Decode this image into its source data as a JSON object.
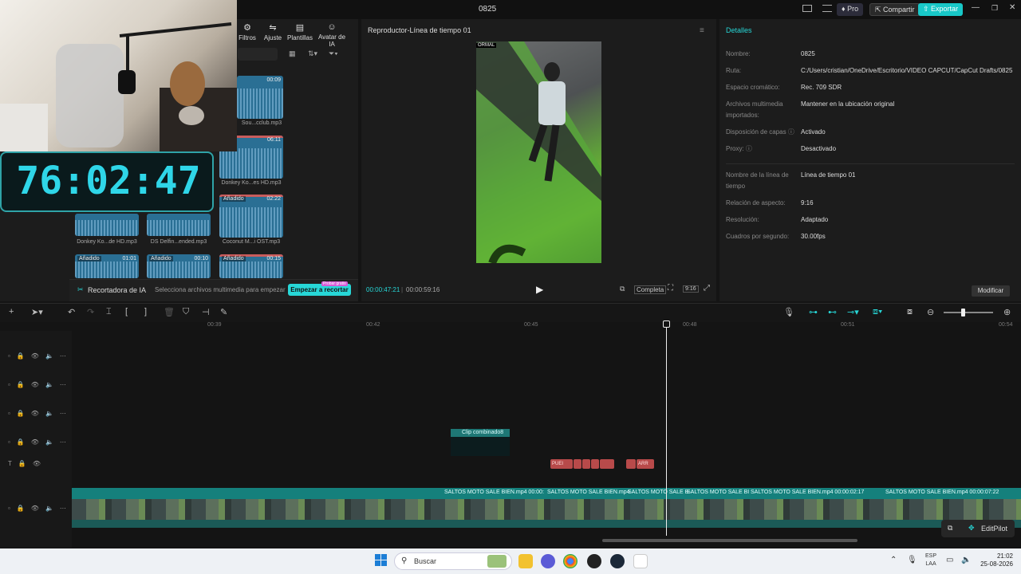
{
  "window": {
    "project_name": "0825",
    "pro_label": "Pro",
    "share_label": "Compartir",
    "export_label": "Exportar"
  },
  "media_panel": {
    "tabs": [
      {
        "label": "Filtros",
        "icon": "filter-icon"
      },
      {
        "label": "Ajuste",
        "icon": "adjust-icon"
      },
      {
        "label": "Plantillas",
        "icon": "template-icon"
      },
      {
        "label": "Avatar de IA",
        "icon": "avatar-icon"
      }
    ],
    "items": [
      {
        "name": "Sou...cclub.mp3",
        "duration": "00:09",
        "added": ""
      },
      {
        "name": "Donkey Ko...es HD.mp3",
        "duration": "06:11",
        "added": ""
      },
      {
        "name": "Donkey Ko...de HD.mp3",
        "duration": "",
        "added": ""
      },
      {
        "name": "DS Delfin...ended.mp3",
        "duration": "",
        "added": ""
      },
      {
        "name": "Coconut M...i OST.mp3",
        "duration": "02:22",
        "added": "Añadido"
      },
      {
        "name": "",
        "duration": "01:01",
        "added": "Añadido"
      },
      {
        "name": "",
        "duration": "00:10",
        "added": "Añadido"
      },
      {
        "name": "",
        "duration": "00:15",
        "added": "Añadido"
      }
    ],
    "ai_bar": {
      "title": "Recortadora de IA",
      "description": "Selecciona archivos multimedia para empezar",
      "button": "Empezar a recortar",
      "badge": "Probar gratis"
    }
  },
  "overlay": {
    "timer": "76:02:47"
  },
  "player": {
    "title": "Reproductor-Línea de tiempo 01",
    "frame_text": "ORMAL",
    "current_time": "00:00:47:21",
    "total_time": "00:00:59:16",
    "complete_label": "Completa",
    "ratio_label": "9:16"
  },
  "details": {
    "title": "Detalles",
    "rows": [
      {
        "label": "Nombre:",
        "value": "0825"
      },
      {
        "label": "Ruta:",
        "value": "C:/Users/cristian/OneDrive/Escritorio/VIDEO CAPCUT/CapCut Drafts/0825"
      },
      {
        "label": "Espacio cromático:",
        "value": "Rec. 709 SDR"
      },
      {
        "label": "Archivos multimedia importados:",
        "value": "Mantener en la ubicación original"
      },
      {
        "label": "Disposición de capas ⓘ",
        "value": "Activado"
      },
      {
        "label": "Proxy: ⓘ",
        "value": "Desactivado"
      },
      {
        "label": "Nombre de la línea de tiempo",
        "value": "Línea de tiempo 01"
      },
      {
        "label": "Relación de aspecto:",
        "value": "9:16"
      },
      {
        "label": "Resolución:",
        "value": "Adaptado"
      },
      {
        "label": "Cuadros por segundo:",
        "value": "30.00fps"
      }
    ],
    "modify_label": "Modificar"
  },
  "timeline": {
    "ruler": [
      "00:39",
      "00:42",
      "00:45",
      "00:48",
      "00:51",
      "00:54"
    ],
    "combined_clip": "Clip combinado8",
    "red_clips": [
      "PUEI",
      "ARR"
    ],
    "main_clips": [
      "SALTOS MOTO SALE BIEN.mp4  00:00:",
      "SALTOS MOTO SALE BIEN.mp4",
      "SALTOS MOTO SALE B",
      "SALTOS MOTO SALE BI",
      "SALTOS MOTO SALE BIEN.mp4  00:00:02:17",
      "SALTOS MOTO SALE BIEN.mp4  00:00:07:22"
    ],
    "editpilot": "EditPilot"
  },
  "taskbar": {
    "search": "Buscar",
    "lang_top": "ESP",
    "lang_bottom": "LAA",
    "time": "21:02",
    "date": "25-08-2026"
  }
}
